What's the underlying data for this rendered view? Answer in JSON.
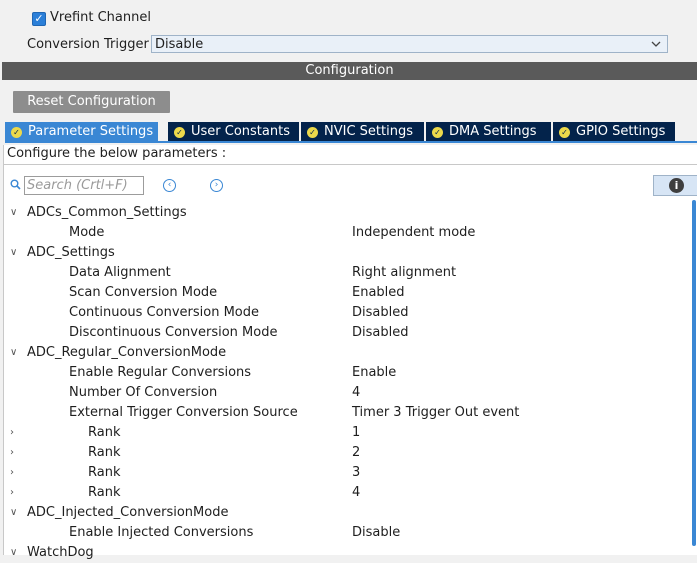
{
  "top": {
    "vrefint_label": "Vrefint Channel",
    "vrefint_checked": true,
    "trigger_label": "Conversion Trigger",
    "trigger_value": "Disable"
  },
  "config_title": "Configuration",
  "reset_label": "Reset Configuration",
  "tabs": [
    {
      "label": "Parameter Settings",
      "active": true
    },
    {
      "label": "User Constants",
      "active": false
    },
    {
      "label": "NVIC Settings",
      "active": false
    },
    {
      "label": "DMA Settings",
      "active": false
    },
    {
      "label": "GPIO Settings",
      "active": false
    }
  ],
  "panel": {
    "instruction": "Configure the below parameters :",
    "search_placeholder": "Search (Crtl+F)"
  },
  "tree": [
    {
      "kind": "group",
      "label": "ADCs_Common_Settings",
      "expanded": true
    },
    {
      "kind": "param",
      "label": "Mode",
      "value": "Independent mode"
    },
    {
      "kind": "group",
      "label": "ADC_Settings",
      "expanded": true
    },
    {
      "kind": "param",
      "label": "Data Alignment",
      "value": "Right alignment"
    },
    {
      "kind": "param",
      "label": "Scan Conversion Mode",
      "value": "Enabled"
    },
    {
      "kind": "param",
      "label": "Continuous Conversion Mode",
      "value": "Disabled"
    },
    {
      "kind": "param",
      "label": "Discontinuous Conversion Mode",
      "value": "Disabled"
    },
    {
      "kind": "group",
      "label": "ADC_Regular_ConversionMode",
      "expanded": true
    },
    {
      "kind": "param",
      "label": "Enable Regular Conversions",
      "value": "Enable"
    },
    {
      "kind": "param",
      "label": "Number Of Conversion",
      "value": "4"
    },
    {
      "kind": "param",
      "label": "External Trigger Conversion Source",
      "value": "Timer 3 Trigger Out event"
    },
    {
      "kind": "sub",
      "label": "Rank",
      "value": "1",
      "expanded": false
    },
    {
      "kind": "sub",
      "label": "Rank",
      "value": "2",
      "expanded": false
    },
    {
      "kind": "sub",
      "label": "Rank",
      "value": "3",
      "expanded": false
    },
    {
      "kind": "sub",
      "label": "Rank",
      "value": "4",
      "expanded": false
    },
    {
      "kind": "group",
      "label": "ADC_Injected_ConversionMode",
      "expanded": true
    },
    {
      "kind": "param",
      "label": "Enable Injected Conversions",
      "value": "Disable"
    },
    {
      "kind": "group",
      "label": "WatchDog",
      "expanded": true
    }
  ],
  "colors": {
    "tab_active": "#3a87d4",
    "tab_inactive": "#03234b",
    "tab_icon": "#ecd94b",
    "config_bar": "#5a5a5a",
    "reset_button": "#8d8d8d"
  }
}
